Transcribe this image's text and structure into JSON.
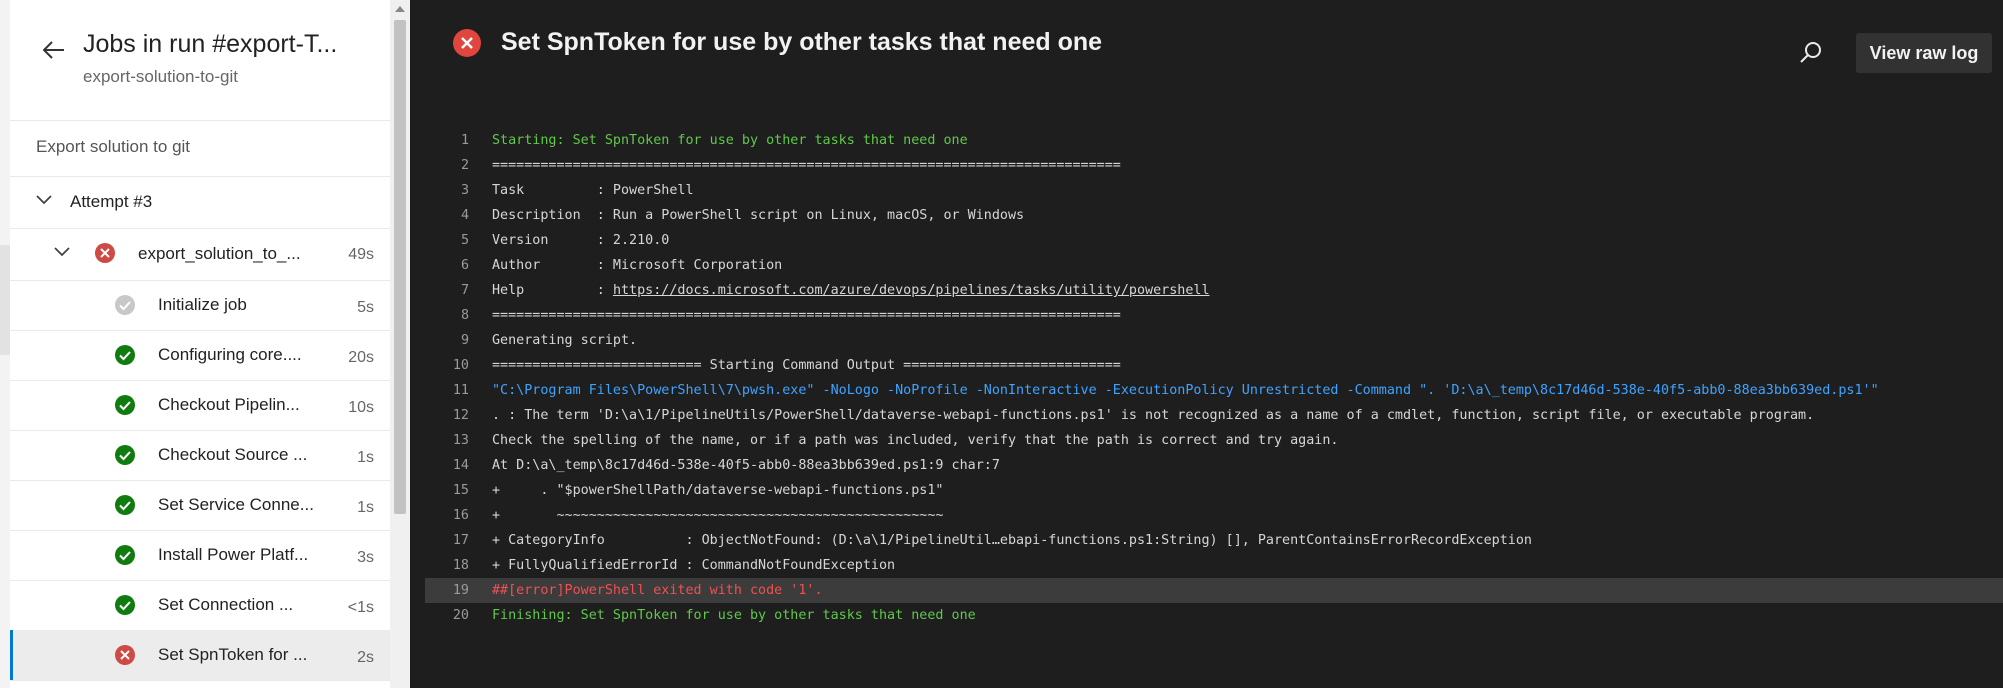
{
  "sidebar": {
    "title": "Jobs in run #export-T...",
    "subtitle": "export-solution-to-git",
    "stage": "Export solution to git",
    "attempt": "Attempt #3",
    "job": {
      "label": "export_solution_to_...",
      "duration": "49s",
      "status": "failed"
    },
    "steps": [
      {
        "label": "Initialize job",
        "duration": "5s",
        "status": "skipped"
      },
      {
        "label": "Configuring core....",
        "duration": "20s",
        "status": "succeeded"
      },
      {
        "label": "Checkout Pipelin...",
        "duration": "10s",
        "status": "succeeded"
      },
      {
        "label": "Checkout Source ...",
        "duration": "1s",
        "status": "succeeded"
      },
      {
        "label": "Set Service Conne...",
        "duration": "1s",
        "status": "succeeded"
      },
      {
        "label": "Install Power Platf...",
        "duration": "3s",
        "status": "succeeded"
      },
      {
        "label": "Set Connection ...",
        "duration": "<1s",
        "status": "succeeded"
      },
      {
        "label": "Set SpnToken for ...",
        "duration": "2s",
        "status": "failed",
        "selected": true
      }
    ]
  },
  "log": {
    "title": "Set SpnToken for use by other tasks that need one",
    "view_raw_label": "View raw log",
    "lines": [
      {
        "n": "1",
        "text": "Starting: Set SpnToken for use by other tasks that need one",
        "style": "green"
      },
      {
        "n": "2",
        "text": "==============================================================================",
        "style": "normal"
      },
      {
        "n": "3",
        "text": "Task         : PowerShell",
        "style": "normal"
      },
      {
        "n": "4",
        "text": "Description  : Run a PowerShell script on Linux, macOS, or Windows",
        "style": "normal"
      },
      {
        "n": "5",
        "text": "Version      : 2.210.0",
        "style": "normal"
      },
      {
        "n": "6",
        "text": "Author       : Microsoft Corporation",
        "style": "normal"
      },
      {
        "n": "7",
        "text": "Help         : ",
        "link": "https://docs.microsoft.com/azure/devops/pipelines/tasks/utility/powershell",
        "style": "normal"
      },
      {
        "n": "8",
        "text": "==============================================================================",
        "style": "normal"
      },
      {
        "n": "9",
        "text": "Generating script.",
        "style": "normal"
      },
      {
        "n": "10",
        "text": "========================== Starting Command Output ===========================",
        "style": "normal"
      },
      {
        "n": "11",
        "text": "\"C:\\Program Files\\PowerShell\\7\\pwsh.exe\" -NoLogo -NoProfile -NonInteractive -ExecutionPolicy Unrestricted -Command \". 'D:\\a\\_temp\\8c17d46d-538e-40f5-abb0-88ea3bb639ed.ps1'\"",
        "style": "blue"
      },
      {
        "n": "12",
        "text": ". : The term 'D:\\a\\1/PipelineUtils/PowerShell/dataverse-webapi-functions.ps1' is not recognized as a name of a cmdlet, function, script file, or executable program.",
        "style": "normal"
      },
      {
        "n": "13",
        "text": "Check the spelling of the name, or if a path was included, verify that the path is correct and try again.",
        "style": "normal"
      },
      {
        "n": "14",
        "text": "At D:\\a\\_temp\\8c17d46d-538e-40f5-abb0-88ea3bb639ed.ps1:9 char:7",
        "style": "normal"
      },
      {
        "n": "15",
        "text": "+     . \"$powerShellPath/dataverse-webapi-functions.ps1\"",
        "style": "normal"
      },
      {
        "n": "16",
        "text": "+       ~~~~~~~~~~~~~~~~~~~~~~~~~~~~~~~~~~~~~~~~~~~~~~~~",
        "style": "normal"
      },
      {
        "n": "17",
        "text": "+ CategoryInfo          : ObjectNotFound: (D:\\a\\1/PipelineUtil…ebapi-functions.ps1:String) [], ParentContainsErrorRecordException",
        "style": "normal"
      },
      {
        "n": "18",
        "text": "+ FullyQualifiedErrorId : CommandNotFoundException",
        "style": "normal"
      },
      {
        "n": "19",
        "text": "##[error]PowerShell exited with code '1'.",
        "style": "red"
      },
      {
        "n": "20",
        "text": "Finishing: Set SpnToken for use by other tasks that need one",
        "style": "green"
      }
    ]
  },
  "colors": {
    "success": "#107c10",
    "failed": "#cd4a45",
    "skipped": "#c8c8c8",
    "accent": "#0078d4"
  }
}
